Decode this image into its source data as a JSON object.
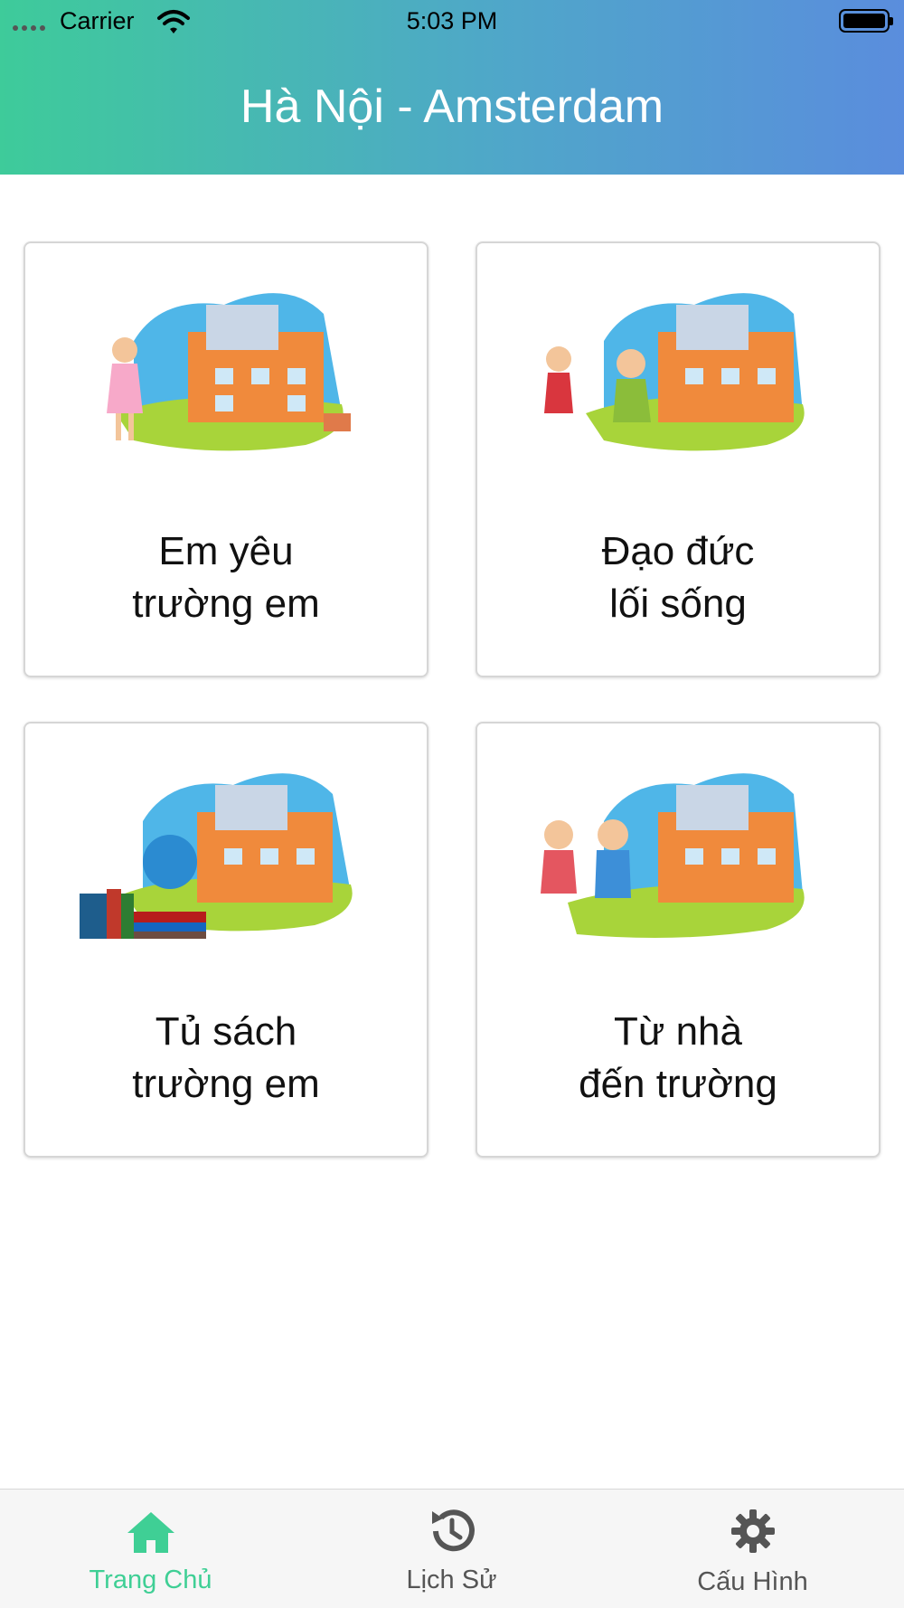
{
  "status_bar": {
    "carrier": "Carrier",
    "time": "5:03 PM"
  },
  "header": {
    "title": "Hà Nội - Amsterdam",
    "gradient_colors": [
      "#3ecb9a",
      "#5a8ddd"
    ]
  },
  "cards": [
    {
      "line1": "Em yêu",
      "line2": "trường em",
      "image": "school-girl-painting-illustration"
    },
    {
      "line1": "Đạo đức",
      "line2": "lối sống",
      "image": "school-kids-waving-illustration"
    },
    {
      "line1": "Tủ sách",
      "line2": "trường em",
      "image": "school-books-globe-illustration"
    },
    {
      "line1": "Từ nhà",
      "line2": "đến trường",
      "image": "school-kids-walking-illustration"
    }
  ],
  "tabbar": {
    "active_color": "#3fcf95",
    "inactive_color": "#555555",
    "tabs": [
      {
        "label": "Trang Chủ",
        "icon": "home-icon",
        "active": true
      },
      {
        "label": "Lịch Sử",
        "icon": "history-icon",
        "active": false
      },
      {
        "label": "Cấu Hình",
        "icon": "gear-icon",
        "active": false
      }
    ]
  }
}
